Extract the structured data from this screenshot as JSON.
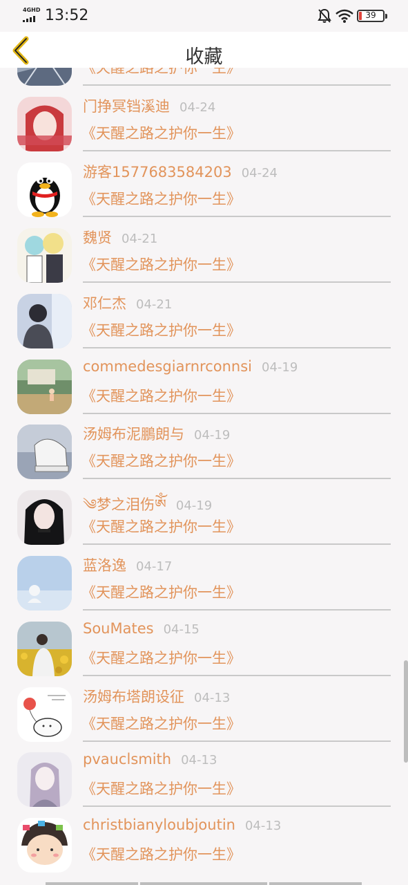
{
  "status_bar": {
    "network": "4GHD",
    "time": "13:52",
    "battery_level": "39",
    "icons": [
      "signal-icon",
      "mute-bell-icon",
      "wifi-icon",
      "battery-icon"
    ]
  },
  "header": {
    "title": "收藏",
    "back_icon": "chevron-left-icon"
  },
  "colors": {
    "accent": "#e2945b",
    "date": "#bdbdbd",
    "divider": "#c9c9c9",
    "background": "#f7f5f6"
  },
  "items": [
    {
      "name": "",
      "date": "",
      "title": "《天醒之路之护你一生》",
      "avatar": "bridge-photo"
    },
    {
      "name": "门挣冥铛溪迪",
      "date": "04-24",
      "title": "《天醒之路之护你一生》",
      "avatar": "red-hair-girl"
    },
    {
      "name": "游客1577683584203",
      "date": "04-24",
      "title": "《天醒之路之护你一生》",
      "avatar": "qq-penguin"
    },
    {
      "name": "魏贤",
      "date": "04-21",
      "title": "《天醒之路之护你一生》",
      "avatar": "anime-boys"
    },
    {
      "name": "邓仁杰",
      "date": "04-21",
      "title": "《天醒之路之护你一生》",
      "avatar": "boy-window"
    },
    {
      "name": "commedesgiarnrconnsi",
      "date": "04-19",
      "title": "《天醒之路之护你一生》",
      "avatar": "kid-park"
    },
    {
      "name": "汤姆布泥鵬朗与",
      "date": "04-19",
      "title": "《天醒之路之护你一生》",
      "avatar": "sneaker"
    },
    {
      "name": "༄梦之泪伤ༀ",
      "date": "04-19",
      "title": "《天醒之路之护你一生》",
      "avatar": "dark-hair-girl"
    },
    {
      "name": "蓝洛逸",
      "date": "04-17",
      "title": "《天醒之路之护你一生》",
      "avatar": "sky-figure"
    },
    {
      "name": "SouMates",
      "date": "04-15",
      "title": "《天醒之路之护你一生》",
      "avatar": "sunflower-field"
    },
    {
      "name": "汤姆布塔朗设征",
      "date": "04-13",
      "title": "《天醒之路之护你一生》",
      "avatar": "balloon-doodle"
    },
    {
      "name": "pvauclsmith",
      "date": "04-13",
      "title": "《天醒之路之护你一生》",
      "avatar": "anime-girl-hoodie"
    },
    {
      "name": "christbianyloubjoutin",
      "date": "04-13",
      "title": "《天醒之路之护你一生》",
      "avatar": "cartoon-kid"
    }
  ]
}
